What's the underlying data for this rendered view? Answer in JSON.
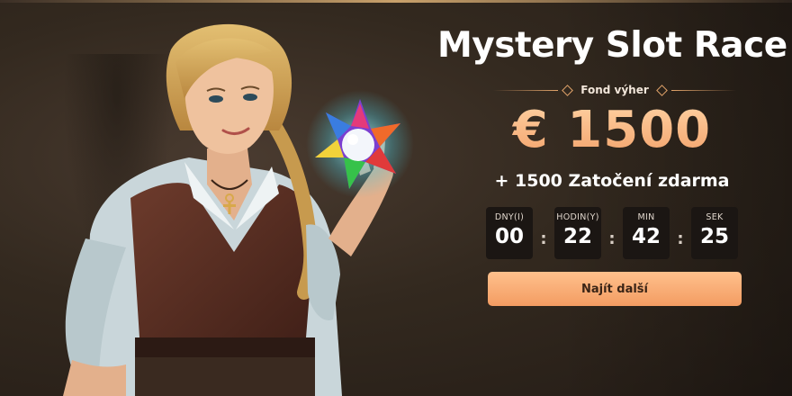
{
  "promo": {
    "title": "Mystery Slot Race",
    "fund_label": "Fond výher",
    "prize_amount": "€ 1500",
    "free_spins": "+ 1500 Zatočení zdarma",
    "cta_label": "Najít další"
  },
  "countdown": {
    "units": [
      {
        "label": "DNY(I)",
        "value": "00"
      },
      {
        "label": "HODIN(Y)",
        "value": "22"
      },
      {
        "label": "MIN",
        "value": "42"
      },
      {
        "label": "SEK",
        "value": "25"
      }
    ],
    "separator": ":"
  },
  "colors": {
    "accent": "#f39c62",
    "prize": "#f7b27a",
    "background": "#2a221d"
  },
  "icons": [
    "diamond-icon",
    "star-gem-icon",
    "ankh-pendant-icon"
  ]
}
